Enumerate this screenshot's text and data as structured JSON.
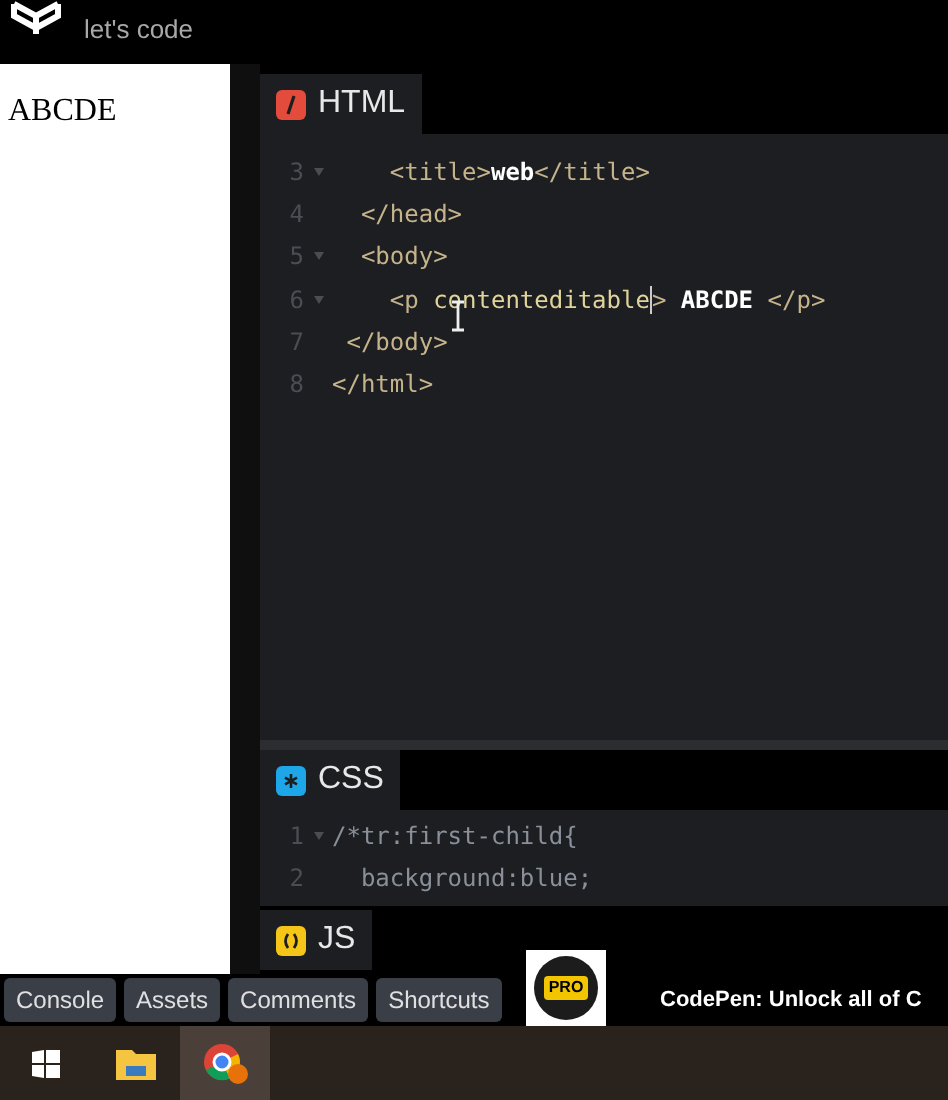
{
  "header": {
    "title": "let's code"
  },
  "preview": {
    "text": "ABCDE"
  },
  "html_panel": {
    "title": "HTML",
    "lines": [
      {
        "number": "3",
        "foldable": true,
        "tokens": [
          {
            "kind": "tag",
            "text": "    <title>"
          },
          {
            "kind": "text",
            "text": "web"
          },
          {
            "kind": "tag",
            "text": "</title>"
          }
        ]
      },
      {
        "number": "4",
        "foldable": false,
        "tokens": [
          {
            "kind": "tag",
            "text": "  </head>"
          }
        ]
      },
      {
        "number": "5",
        "foldable": true,
        "tokens": [
          {
            "kind": "tag",
            "text": "  <body>"
          }
        ]
      },
      {
        "number": "6",
        "foldable": true,
        "tokens": [
          {
            "kind": "tag",
            "text": "    <p"
          },
          {
            "kind": "attr",
            "text": " contenteditable"
          },
          {
            "kind": "caret",
            "text": ">"
          },
          {
            "kind": "text",
            "text": " ABCDE "
          },
          {
            "kind": "tag",
            "text": "</p>"
          }
        ]
      },
      {
        "number": "7",
        "foldable": false,
        "tokens": [
          {
            "kind": "tag",
            "text": " </body>"
          }
        ]
      },
      {
        "number": "8",
        "foldable": false,
        "tokens": [
          {
            "kind": "tag",
            "text": "</html>"
          }
        ]
      }
    ]
  },
  "css_panel": {
    "title": "CSS",
    "lines": [
      {
        "number": "1",
        "foldable": true,
        "tokens": [
          {
            "kind": "comment",
            "text": "/*tr:first-child{"
          }
        ]
      },
      {
        "number": "2",
        "foldable": false,
        "tokens": [
          {
            "kind": "comment",
            "text": "  background:blue;"
          }
        ]
      }
    ]
  },
  "js_panel": {
    "title": "JS"
  },
  "bottom_buttons": [
    "Console",
    "Assets",
    "Comments",
    "Shortcuts"
  ],
  "promo": {
    "badge": "PRO",
    "text": "CodePen: Unlock all of C"
  }
}
